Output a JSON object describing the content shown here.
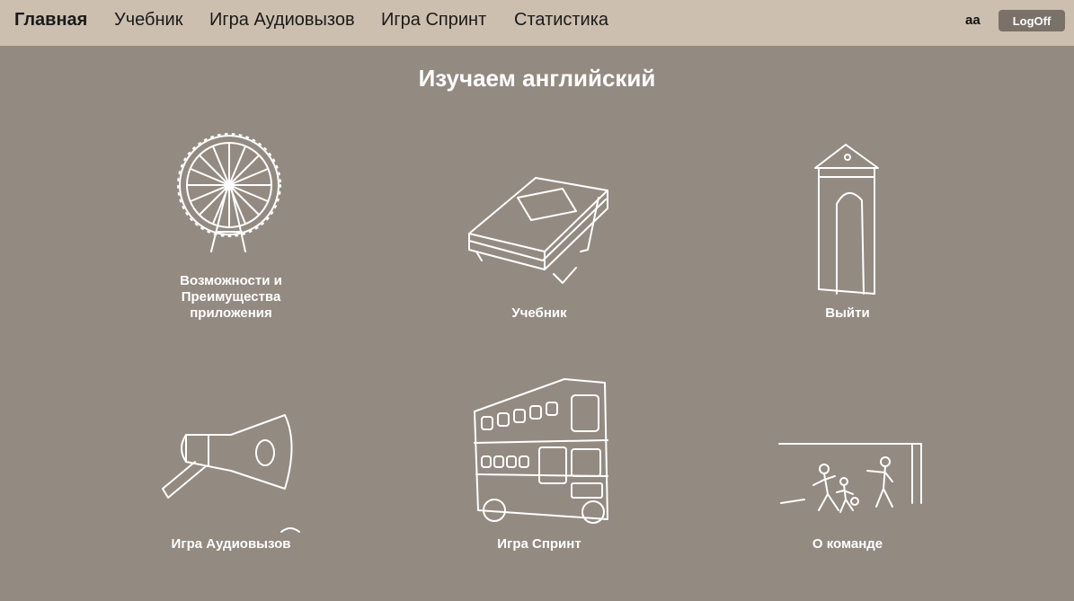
{
  "nav": {
    "items": [
      {
        "label": "Главная",
        "active": true
      },
      {
        "label": "Учебник"
      },
      {
        "label": "Игра Аудиовызов"
      },
      {
        "label": "Игра Спринт"
      },
      {
        "label": "Статистика"
      }
    ],
    "user": "aa",
    "logoff_label": "LogOff"
  },
  "main": {
    "title": "Изучаем английский",
    "cards": [
      {
        "label": "Возможности и Преимущества приложения",
        "icon": "ferris-wheel-icon"
      },
      {
        "label": "Учебник",
        "icon": "book-icon"
      },
      {
        "label": "Выйти",
        "icon": "sentry-box-icon"
      },
      {
        "label": "Игра Аудиовызов",
        "icon": "megaphone-icon"
      },
      {
        "label": "Игра Спринт",
        "icon": "double-decker-bus-icon"
      },
      {
        "label": "О команде",
        "icon": "football-players-icon"
      }
    ]
  },
  "colors": {
    "header_bg": "#cdbfaf",
    "page_bg": "#938a81",
    "button_bg": "#7a7169",
    "text_light": "#ffffff"
  }
}
